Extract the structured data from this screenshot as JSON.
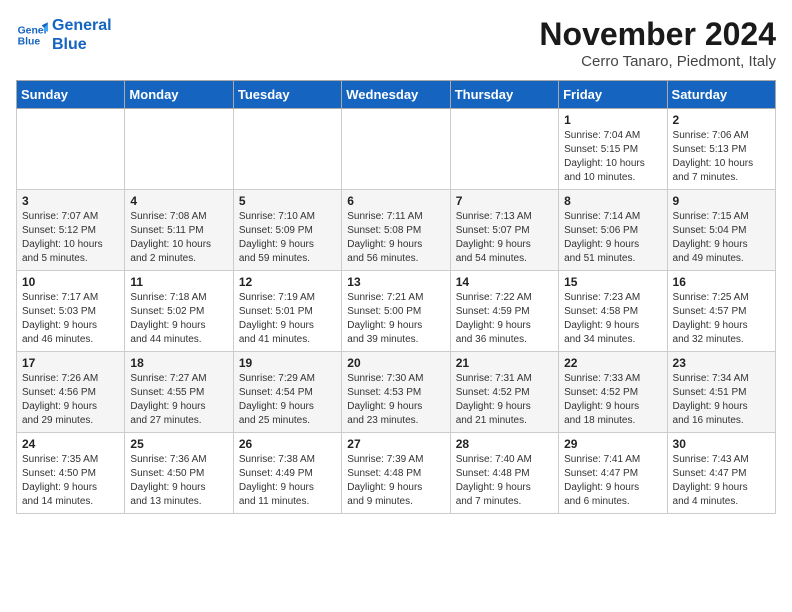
{
  "logo": {
    "line1": "General",
    "line2": "Blue"
  },
  "title": "November 2024",
  "subtitle": "Cerro Tanaro, Piedmont, Italy",
  "weekdays": [
    "Sunday",
    "Monday",
    "Tuesday",
    "Wednesday",
    "Thursday",
    "Friday",
    "Saturday"
  ],
  "weeks": [
    [
      {
        "day": "",
        "detail": ""
      },
      {
        "day": "",
        "detail": ""
      },
      {
        "day": "",
        "detail": ""
      },
      {
        "day": "",
        "detail": ""
      },
      {
        "day": "",
        "detail": ""
      },
      {
        "day": "1",
        "detail": "Sunrise: 7:04 AM\nSunset: 5:15 PM\nDaylight: 10 hours\nand 10 minutes."
      },
      {
        "day": "2",
        "detail": "Sunrise: 7:06 AM\nSunset: 5:13 PM\nDaylight: 10 hours\nand 7 minutes."
      }
    ],
    [
      {
        "day": "3",
        "detail": "Sunrise: 7:07 AM\nSunset: 5:12 PM\nDaylight: 10 hours\nand 5 minutes."
      },
      {
        "day": "4",
        "detail": "Sunrise: 7:08 AM\nSunset: 5:11 PM\nDaylight: 10 hours\nand 2 minutes."
      },
      {
        "day": "5",
        "detail": "Sunrise: 7:10 AM\nSunset: 5:09 PM\nDaylight: 9 hours\nand 59 minutes."
      },
      {
        "day": "6",
        "detail": "Sunrise: 7:11 AM\nSunset: 5:08 PM\nDaylight: 9 hours\nand 56 minutes."
      },
      {
        "day": "7",
        "detail": "Sunrise: 7:13 AM\nSunset: 5:07 PM\nDaylight: 9 hours\nand 54 minutes."
      },
      {
        "day": "8",
        "detail": "Sunrise: 7:14 AM\nSunset: 5:06 PM\nDaylight: 9 hours\nand 51 minutes."
      },
      {
        "day": "9",
        "detail": "Sunrise: 7:15 AM\nSunset: 5:04 PM\nDaylight: 9 hours\nand 49 minutes."
      }
    ],
    [
      {
        "day": "10",
        "detail": "Sunrise: 7:17 AM\nSunset: 5:03 PM\nDaylight: 9 hours\nand 46 minutes."
      },
      {
        "day": "11",
        "detail": "Sunrise: 7:18 AM\nSunset: 5:02 PM\nDaylight: 9 hours\nand 44 minutes."
      },
      {
        "day": "12",
        "detail": "Sunrise: 7:19 AM\nSunset: 5:01 PM\nDaylight: 9 hours\nand 41 minutes."
      },
      {
        "day": "13",
        "detail": "Sunrise: 7:21 AM\nSunset: 5:00 PM\nDaylight: 9 hours\nand 39 minutes."
      },
      {
        "day": "14",
        "detail": "Sunrise: 7:22 AM\nSunset: 4:59 PM\nDaylight: 9 hours\nand 36 minutes."
      },
      {
        "day": "15",
        "detail": "Sunrise: 7:23 AM\nSunset: 4:58 PM\nDaylight: 9 hours\nand 34 minutes."
      },
      {
        "day": "16",
        "detail": "Sunrise: 7:25 AM\nSunset: 4:57 PM\nDaylight: 9 hours\nand 32 minutes."
      }
    ],
    [
      {
        "day": "17",
        "detail": "Sunrise: 7:26 AM\nSunset: 4:56 PM\nDaylight: 9 hours\nand 29 minutes."
      },
      {
        "day": "18",
        "detail": "Sunrise: 7:27 AM\nSunset: 4:55 PM\nDaylight: 9 hours\nand 27 minutes."
      },
      {
        "day": "19",
        "detail": "Sunrise: 7:29 AM\nSunset: 4:54 PM\nDaylight: 9 hours\nand 25 minutes."
      },
      {
        "day": "20",
        "detail": "Sunrise: 7:30 AM\nSunset: 4:53 PM\nDaylight: 9 hours\nand 23 minutes."
      },
      {
        "day": "21",
        "detail": "Sunrise: 7:31 AM\nSunset: 4:52 PM\nDaylight: 9 hours\nand 21 minutes."
      },
      {
        "day": "22",
        "detail": "Sunrise: 7:33 AM\nSunset: 4:52 PM\nDaylight: 9 hours\nand 18 minutes."
      },
      {
        "day": "23",
        "detail": "Sunrise: 7:34 AM\nSunset: 4:51 PM\nDaylight: 9 hours\nand 16 minutes."
      }
    ],
    [
      {
        "day": "24",
        "detail": "Sunrise: 7:35 AM\nSunset: 4:50 PM\nDaylight: 9 hours\nand 14 minutes."
      },
      {
        "day": "25",
        "detail": "Sunrise: 7:36 AM\nSunset: 4:50 PM\nDaylight: 9 hours\nand 13 minutes."
      },
      {
        "day": "26",
        "detail": "Sunrise: 7:38 AM\nSunset: 4:49 PM\nDaylight: 9 hours\nand 11 minutes."
      },
      {
        "day": "27",
        "detail": "Sunrise: 7:39 AM\nSunset: 4:48 PM\nDaylight: 9 hours\nand 9 minutes."
      },
      {
        "day": "28",
        "detail": "Sunrise: 7:40 AM\nSunset: 4:48 PM\nDaylight: 9 hours\nand 7 minutes."
      },
      {
        "day": "29",
        "detail": "Sunrise: 7:41 AM\nSunset: 4:47 PM\nDaylight: 9 hours\nand 6 minutes."
      },
      {
        "day": "30",
        "detail": "Sunrise: 7:43 AM\nSunset: 4:47 PM\nDaylight: 9 hours\nand 4 minutes."
      }
    ]
  ]
}
